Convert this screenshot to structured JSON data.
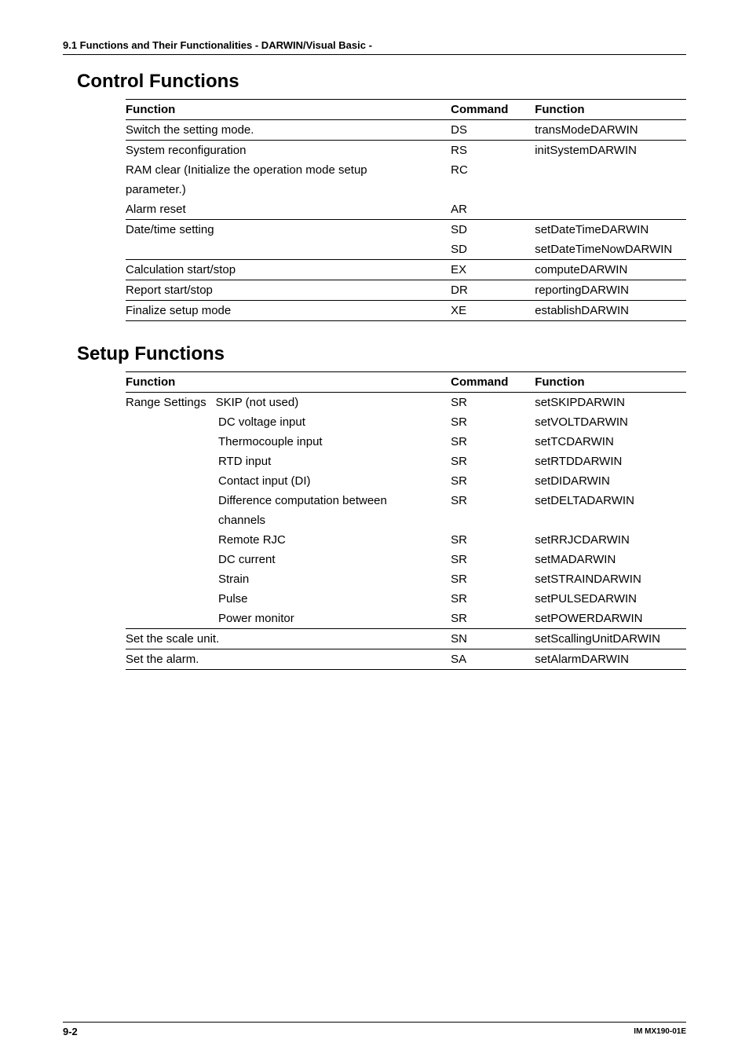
{
  "header": {
    "line": "9.1  Functions and Their Functionalities - DARWIN/Visual Basic -"
  },
  "section1": {
    "title": "Control Functions",
    "cols": {
      "c1": "Function",
      "c2": "Command",
      "c3": "Function"
    },
    "rows": [
      {
        "f": "Switch the setting mode.",
        "c": "DS",
        "fn": "transModeDARWIN",
        "sep": true
      },
      {
        "f": "System reconfiguration",
        "c": "RS",
        "fn": "initSystemDARWIN",
        "sep": true
      },
      {
        "f": "RAM clear (Initialize the operation mode setup",
        "c": "RC",
        "fn": ""
      },
      {
        "f": "parameter.)",
        "c": "",
        "fn": ""
      },
      {
        "f": "Alarm reset",
        "c": "AR",
        "fn": ""
      },
      {
        "f": "Date/time setting",
        "c": "SD",
        "fn": "setDateTimeDARWIN",
        "sep": true
      },
      {
        "f": "",
        "c": "SD",
        "fn": "setDateTimeNowDARWIN"
      },
      {
        "f": "Calculation start/stop",
        "c": "EX",
        "fn": "computeDARWIN",
        "sep": true
      },
      {
        "f": "Report start/stop",
        "c": "DR",
        "fn": "reportingDARWIN",
        "sep": true
      },
      {
        "f": "Finalize setup mode",
        "c": "XE",
        "fn": "establishDARWIN",
        "sep": true,
        "last": true
      }
    ]
  },
  "section2": {
    "title": "Setup Functions",
    "cols": {
      "c1": "Function",
      "c2": "Command",
      "c3": "Function"
    },
    "rows": [
      {
        "f1": "Range Settings",
        "f2": "SKIP (not used)",
        "c": "SR",
        "fn": "setSKIPDARWIN",
        "sep": true
      },
      {
        "f1": "",
        "f2": "DC voltage input",
        "c": "SR",
        "fn": "setVOLTDARWIN"
      },
      {
        "f1": "",
        "f2": "Thermocouple input",
        "c": "SR",
        "fn": "setTCDARWIN"
      },
      {
        "f1": "",
        "f2": "RTD input",
        "c": "SR",
        "fn": "setRTDDARWIN"
      },
      {
        "f1": "",
        "f2": "Contact input (DI)",
        "c": "SR",
        "fn": "setDIDARWIN"
      },
      {
        "f1": "",
        "f2": "Difference computation between",
        "c": "SR",
        "fn": "setDELTADARWIN"
      },
      {
        "f1": "",
        "f2": "channels",
        "c": "",
        "fn": ""
      },
      {
        "f1": "",
        "f2": "Remote RJC",
        "c": "SR",
        "fn": "setRRJCDARWIN"
      },
      {
        "f1": "",
        "f2": "DC current",
        "c": "SR",
        "fn": "setMADARWIN"
      },
      {
        "f1": "",
        "f2": "Strain",
        "c": "SR",
        "fn": "setSTRAINDARWIN"
      },
      {
        "f1": "",
        "f2": "Pulse",
        "c": "SR",
        "fn": "setPULSEDARWIN"
      },
      {
        "f1": "",
        "f2": "Power monitor",
        "c": "SR",
        "fn": "setPOWERDARWIN"
      },
      {
        "f1": "Set the scale unit.",
        "f2": "",
        "c": "SN",
        "fn": "setScallingUnitDARWIN",
        "sep": true
      },
      {
        "f1": "Set the alarm.",
        "f2": "",
        "c": "SA",
        "fn": "setAlarmDARWIN",
        "sep": true,
        "last": true
      }
    ]
  },
  "footer": {
    "page": "9-2",
    "doc": "IM MX190-01E"
  }
}
